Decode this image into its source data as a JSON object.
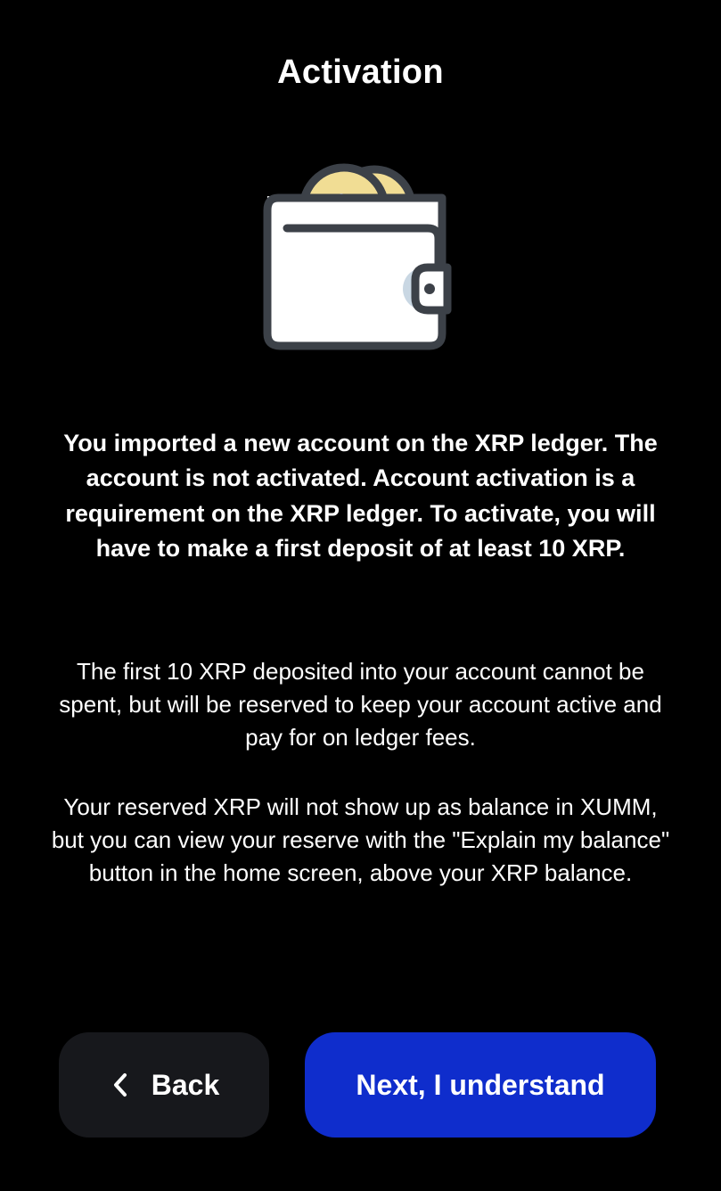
{
  "header": {
    "title": "Activation"
  },
  "illustration": {
    "icon": "wallet-with-coins-icon",
    "colors": {
      "wallet_body": "#ffffff",
      "outline": "#3c4148",
      "coin": "#f1dd94",
      "clasp": "#c9d7e3"
    }
  },
  "content": {
    "headline": "You imported a new account on the XRP ledger. The account is not activated. Account activation is a requirement on the XRP ledger. To activate, you will have to make a first deposit of at least 10 XRP.",
    "paragraph_1": "The first 10 XRP deposited into your account cannot be spent, but will be reserved to keep your account active and pay for on ledger fees.",
    "paragraph_2": "Your reserved XRP will not show up as balance in XUMM, but you can view your reserve with the \"Explain my balance\" button in the home screen, above your XRP balance."
  },
  "footer": {
    "back_label": "Back",
    "back_icon": "chevron-left-icon",
    "next_label": "Next, I understand",
    "colors": {
      "back_bg": "#17181c",
      "next_bg": "#0f2dcc"
    }
  }
}
